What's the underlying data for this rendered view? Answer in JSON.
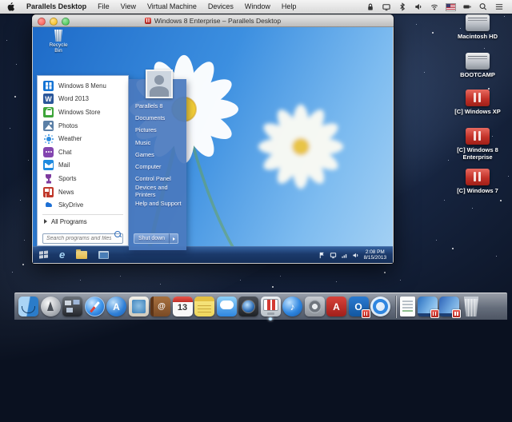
{
  "menu_bar": {
    "app_menus": [
      "Parallels Desktop",
      "File",
      "View",
      "Virtual Machine",
      "Devices",
      "Window",
      "Help"
    ],
    "status_icons": [
      "lock-icon",
      "displays-icon",
      "bluetooth-icon",
      "volume-icon",
      "wifi-icon",
      "input-language-us-flag-icon",
      "battery-icon",
      "spotlight-icon",
      "notification-center-icon"
    ]
  },
  "window": {
    "title": "Windows 8 Enterprise – Parallels Desktop"
  },
  "vm": {
    "recycle_bin_label": "Recycle Bin"
  },
  "start_menu": {
    "left_items": [
      {
        "label": "Windows 8 Menu",
        "icon": "windows-8-menu-icon"
      },
      {
        "label": "Word 2013",
        "icon": "word-icon"
      },
      {
        "label": "Windows Store",
        "icon": "windows-store-icon"
      },
      {
        "label": "Photos",
        "icon": "photos-icon"
      },
      {
        "label": "Weather",
        "icon": "weather-sun-icon"
      },
      {
        "label": "Chat",
        "icon": "chat-icon"
      },
      {
        "label": "Mail",
        "icon": "mail-envelope-icon"
      },
      {
        "label": "Sports",
        "icon": "sports-trophy-icon"
      },
      {
        "label": "News",
        "icon": "news-icon"
      },
      {
        "label": "SkyDrive",
        "icon": "skydrive-cloud-icon"
      }
    ],
    "all_programs_label": "All Programs",
    "search_placeholder": "Search programs and files",
    "right_items": [
      "Parallels 8",
      "Documents",
      "Pictures",
      "Music",
      "Games",
      "Computer",
      "Control Panel",
      "Devices and Printers",
      "Help and Support"
    ],
    "shutdown_label": "Shut down"
  },
  "taskbar": {
    "time": "2:08 PM",
    "date": "8/15/2013",
    "pinned_icons": [
      "start-button",
      "internet-explorer-icon",
      "file-explorer-icon",
      "shared-apps-icon"
    ],
    "tray_icons": [
      "action-center-flag-icon",
      "display-icon",
      "network-icon",
      "speaker-icon"
    ]
  },
  "desktop_icons": [
    {
      "label": "Macintosh HD",
      "icon": "mac-hard-drive-icon"
    },
    {
      "label": "BOOTCAMP",
      "icon": "mac-hard-drive-icon"
    },
    {
      "label": "[C] Windows XP",
      "icon": "parallels-drive-icon"
    },
    {
      "label": "[C] Windows 8 Enterprise",
      "icon": "parallels-drive-icon"
    },
    {
      "label": "[C] Windows 7",
      "icon": "parallels-drive-icon"
    }
  ],
  "dock": {
    "calendar_day": "13",
    "items": [
      "finder",
      "launchpad",
      "mission-control",
      "safari",
      "app-store",
      "mail",
      "contacts",
      "calendar",
      "notes",
      "messages",
      "photo-booth",
      "parallels-desktop",
      "itunes",
      "system-preferences",
      "adobe-reader",
      "outlook",
      "quicktime",
      "separator",
      "document",
      "windows-8-vm-window",
      "windows-7-vm-window",
      "trash"
    ]
  }
}
